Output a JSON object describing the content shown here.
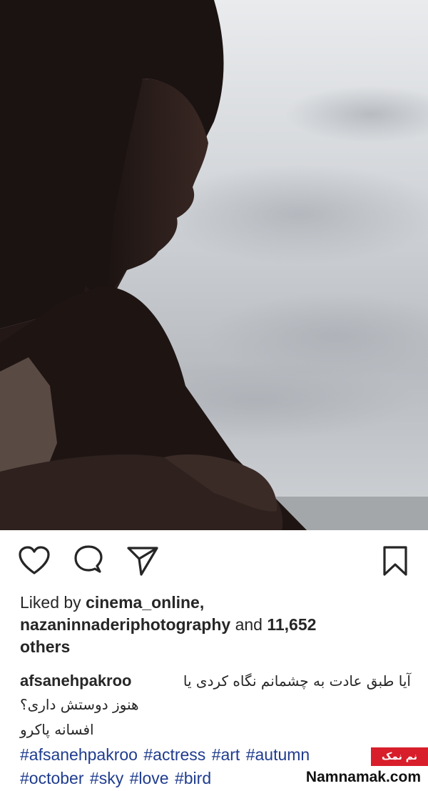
{
  "post": {
    "image_icon": "portrait-photo",
    "actions": {
      "like_icon": "heart-icon",
      "comment_icon": "comment-icon",
      "share_icon": "send-icon",
      "save_icon": "bookmark-icon"
    },
    "likes": {
      "prefix": "Liked by",
      "user1": "cinema_online,",
      "user2": "nazaninnaderiphotography",
      "middle": "and",
      "count": "11,652",
      "suffix": "others"
    },
    "caption": {
      "username": "afsanehpakroo",
      "line1": "آیا طبق عادت به چشمانم نگاه کردی یا",
      "line2": "هنوز دوستش داری؟",
      "line3": "افسانه پاکرو"
    },
    "hashtags": [
      "#afsanehpakroo",
      "#actress",
      "#art",
      "#autumn",
      "#october",
      "#sky",
      "#love",
      "#bird"
    ]
  },
  "watermark": {
    "badge": "نم نمک",
    "site": "Namnamak.com"
  },
  "colors": {
    "hashtag": "#1f3c8f",
    "badge": "#d81e2a",
    "sky": "#c9ccd0",
    "silhouette": "#2a1e1c"
  }
}
